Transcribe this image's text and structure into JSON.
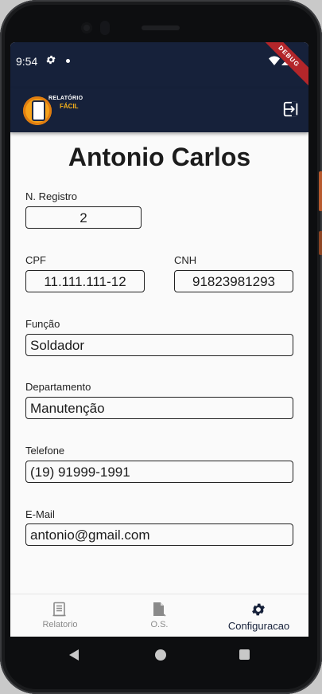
{
  "status_bar": {
    "time": "9:54",
    "debug_banner": "DEBUG"
  },
  "app_bar": {
    "logo_line1": "RELATÓRIO",
    "logo_line2": "FÁCIL"
  },
  "profile": {
    "name": "Antonio Carlos",
    "fields": {
      "registro": {
        "label": "N. Registro",
        "value": "2"
      },
      "cpf": {
        "label": "CPF",
        "value": "11.111.111-12"
      },
      "cnh": {
        "label": "CNH",
        "value": "91823981293"
      },
      "funcao": {
        "label": "Função",
        "value": "Soldador"
      },
      "departamento": {
        "label": "Departamento",
        "value": "Manutenção"
      },
      "telefone": {
        "label": "Telefone",
        "value": "(19) 91999-1991"
      },
      "email": {
        "label": "E-Mail",
        "value": "antonio@gmail.com"
      }
    }
  },
  "bottom_nav": {
    "items": [
      {
        "label": "Relatorio",
        "icon": "document-icon"
      },
      {
        "label": "O.S.",
        "icon": "file-arrow-icon"
      },
      {
        "label": "Configuracao",
        "icon": "gear-icon",
        "active": true
      }
    ]
  },
  "colors": {
    "app_bar": "#16213a",
    "accent": "#f6a21a",
    "debug": "#b3262a",
    "background": "#fafafa"
  }
}
